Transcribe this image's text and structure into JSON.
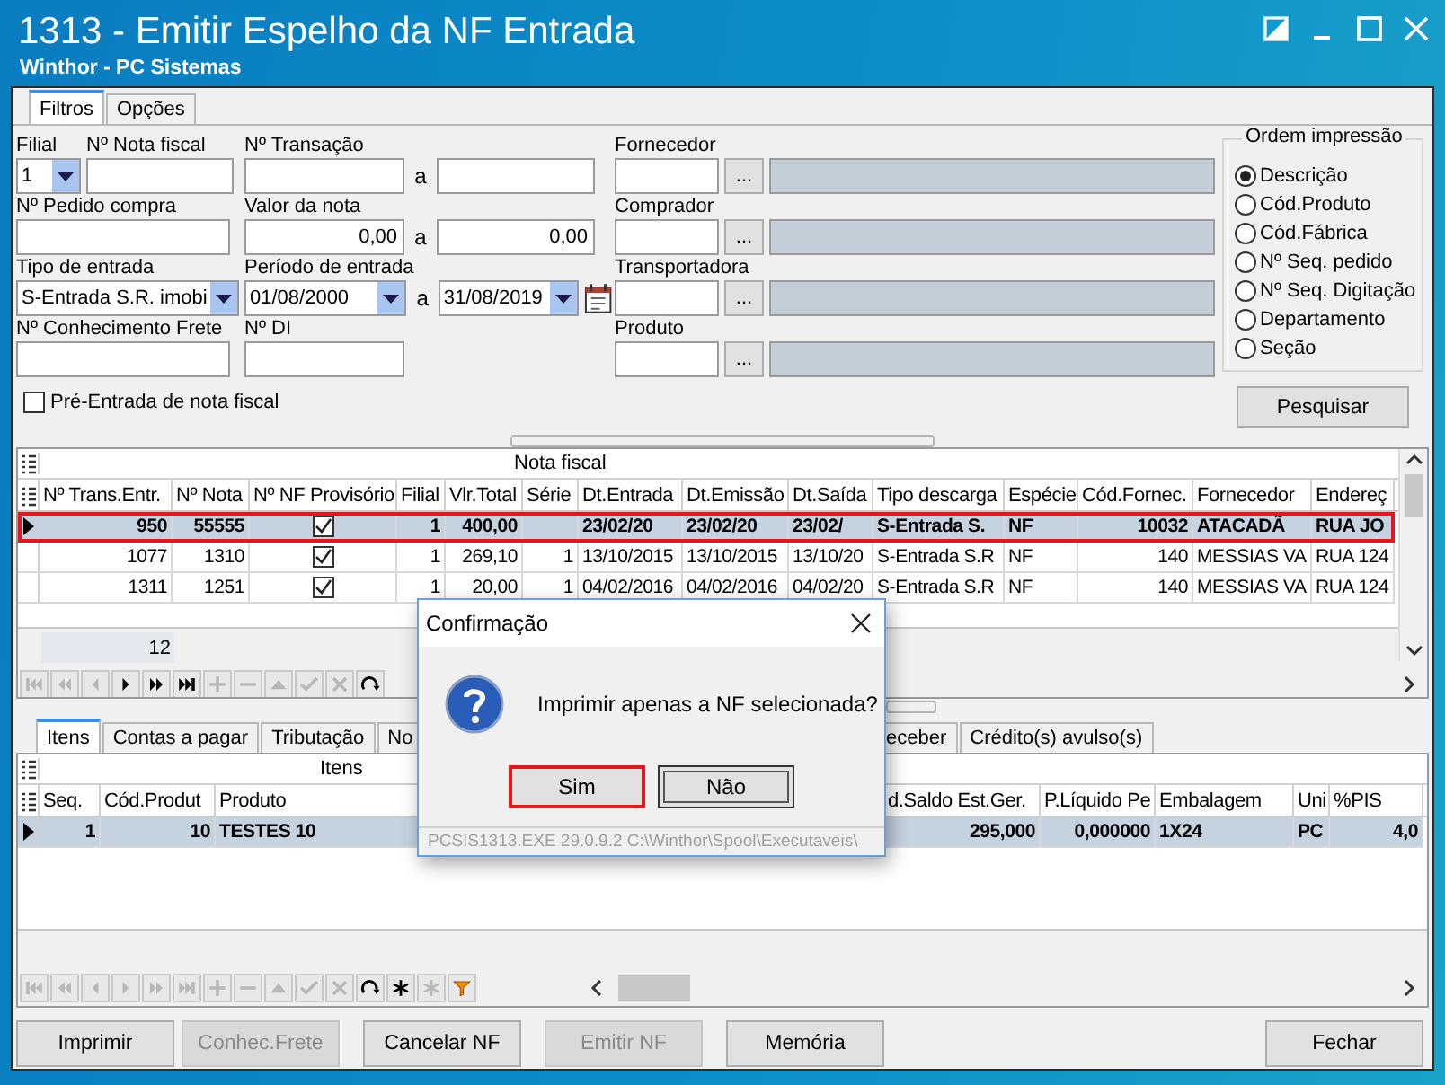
{
  "window": {
    "title": "1313 - Emitir Espelho da NF Entrada",
    "subtitle": "Winthor - PC Sistemas"
  },
  "tabs": [
    {
      "label": "Filtros",
      "selected": true
    },
    {
      "label": "Opções",
      "selected": false
    }
  ],
  "filter_rows": [
    {
      "left": [
        {
          "kind": "select",
          "label": "Filial",
          "value": "1"
        },
        {
          "kind": "text",
          "label": "Nº Nota fiscal"
        }
      ],
      "middle": {
        "kind": "range",
        "label": "Nº Transação",
        "separator": "a"
      },
      "right": {
        "kind": "lookup",
        "label": "Fornecedor",
        "button": "..."
      }
    },
    {
      "left": [
        {
          "kind": "text",
          "label": "Nº Pedido compra"
        }
      ],
      "middle": {
        "kind": "range",
        "label": "Valor da nota",
        "from": "0,00",
        "to": "0,00",
        "separator": "a"
      },
      "right": {
        "kind": "lookup",
        "label": "Comprador",
        "button": "..."
      }
    },
    {
      "left": [
        {
          "kind": "select",
          "label": "Tipo de entrada",
          "value": "S-Entrada S.R. imobi"
        }
      ],
      "middle": {
        "kind": "date_range",
        "label": "Período de entrada",
        "from": "01/08/2000",
        "to": "31/08/2019",
        "separator": "a"
      },
      "right": {
        "kind": "lookup",
        "label": "Transportadora",
        "button": "..."
      }
    },
    {
      "left": [
        {
          "kind": "text",
          "label": "Nº Conhecimento Frete"
        }
      ],
      "middle": {
        "kind": "text",
        "label": "Nº DI"
      },
      "right": {
        "kind": "lookup",
        "label": "Produto",
        "button": "..."
      }
    }
  ],
  "pre_entry": {
    "label": "Pré-Entrada de nota fiscal",
    "checked": false
  },
  "print_order": {
    "title": "Ordem impressão",
    "options": [
      {
        "label": "Descrição",
        "selected": true
      },
      {
        "label": "Cód.Produto",
        "selected": false
      },
      {
        "label": "Cód.Fábrica",
        "selected": false
      },
      {
        "label": "Nº Seq. pedido",
        "selected": false
      },
      {
        "label": "Nº Seq. Digitação",
        "selected": false
      },
      {
        "label": "Departamento",
        "selected": false
      },
      {
        "label": "Seção",
        "selected": false
      }
    ]
  },
  "search_button": "Pesquisar",
  "invoice_grid": {
    "title": "Nota fiscal",
    "columns": [
      "Nº Trans.Entr.",
      "Nº Nota",
      "Nº NF Provisório",
      "Filial",
      "Vlr.Total",
      "Série",
      "Dt.Entrada",
      "Dt.Emissão",
      "Dt.Saída",
      "Tipo descarga",
      "Espécie",
      "Cód.Fornec.",
      "Fornecedor",
      "Endereç"
    ],
    "rows": [
      {
        "selected": true,
        "highlighted": true,
        "cells": [
          "950",
          "55555",
          {
            "checked": true
          },
          "1",
          "400,00",
          null,
          "23/02/20",
          "23/02/20",
          "23/02/",
          "S-Entrada S.",
          "NF",
          "10032",
          "ATACADÃ",
          "RUA JO"
        ]
      },
      {
        "selected": false,
        "highlighted": false,
        "cells": [
          "1077",
          "1310",
          {
            "checked": true
          },
          "1",
          "269,10",
          "1",
          "13/10/2015",
          "13/10/2015",
          "13/10/20",
          "S-Entrada S.R",
          "NF",
          "140",
          "MESSIAS VA",
          "RUA 124"
        ]
      },
      {
        "selected": false,
        "highlighted": false,
        "cells": [
          "1311",
          "1251",
          {
            "checked": true
          },
          "1",
          "20,00",
          "1",
          "04/02/2016",
          "04/02/2016",
          "04/02/20",
          "S-Entrada S.R",
          "NF",
          "140",
          "MESSIAS VA",
          "RUA 124"
        ]
      }
    ],
    "footer": "12",
    "nav": [
      {
        "kind": "first",
        "disabled": true
      },
      {
        "kind": "prior_page",
        "disabled": true
      },
      {
        "kind": "prior",
        "disabled": true
      },
      {
        "kind": "next",
        "disabled": false
      },
      {
        "kind": "next_page",
        "disabled": false
      },
      {
        "kind": "last",
        "disabled": false
      },
      {
        "kind": "insert",
        "disabled": true
      },
      {
        "kind": "delete",
        "disabled": true
      },
      {
        "kind": "edit",
        "disabled": true
      },
      {
        "kind": "post",
        "disabled": true
      },
      {
        "kind": "cancel",
        "disabled": true
      },
      {
        "kind": "refresh",
        "disabled": false
      }
    ]
  },
  "detail_tabs": [
    {
      "label": "Itens",
      "selected": true
    },
    {
      "label": "Contas a pagar",
      "selected": false
    },
    {
      "label": "Tributação",
      "selected": false
    },
    {
      "label": "No",
      "selected": false
    },
    {
      "label": "eceber",
      "selected": false
    },
    {
      "label": "Crédito(s) avulso(s)",
      "selected": false
    }
  ],
  "items_grid": {
    "title": "Itens",
    "columns": [
      "Seq.",
      "Cód.Produt",
      "Produto",
      "d.Saldo Est.Ger.",
      "P.Líquido Pe",
      "Embalagem",
      "Uni",
      "%PIS"
    ],
    "rows": [
      {
        "selected": true,
        "cells": [
          "1",
          "10",
          "TESTES 10",
          "295,000",
          "0,000000",
          "1X24",
          "PC",
          "4,0"
        ]
      }
    ],
    "nav": [
      {
        "kind": "first",
        "disabled": true
      },
      {
        "kind": "prior_page",
        "disabled": true
      },
      {
        "kind": "prior",
        "disabled": true
      },
      {
        "kind": "next",
        "disabled": true
      },
      {
        "kind": "next_page",
        "disabled": true
      },
      {
        "kind": "last",
        "disabled": true
      },
      {
        "kind": "insert",
        "disabled": true
      },
      {
        "kind": "delete",
        "disabled": true
      },
      {
        "kind": "edit",
        "disabled": true
      },
      {
        "kind": "post",
        "disabled": true
      },
      {
        "kind": "cancel",
        "disabled": true
      },
      {
        "kind": "refresh",
        "disabled": false
      },
      {
        "kind": "asterisk",
        "disabled": false
      },
      {
        "kind": "asterisk",
        "disabled": true
      },
      {
        "kind": "filter",
        "disabled": false
      }
    ]
  },
  "buttons": [
    {
      "label": "Imprimir",
      "disabled": false
    },
    {
      "label": "Conhec.Frete",
      "disabled": true
    },
    {
      "label": "Cancelar NF",
      "disabled": false
    },
    {
      "label": "Emitir NF",
      "disabled": true
    },
    {
      "label": "Memória",
      "disabled": false
    },
    {
      "label": "Fechar",
      "disabled": false
    }
  ],
  "dialog": {
    "title": "Confirmação",
    "message": "Imprimir apenas a NF selecionada?",
    "buttons": [
      {
        "label": "Sim",
        "highlighted": true,
        "focused": false
      },
      {
        "label": "Não",
        "highlighted": false,
        "focused": true
      }
    ],
    "footer": "PCSIS1313.EXE 29.0.9.2 C:\\Winthor\\Spool\\Executaveis\\"
  }
}
